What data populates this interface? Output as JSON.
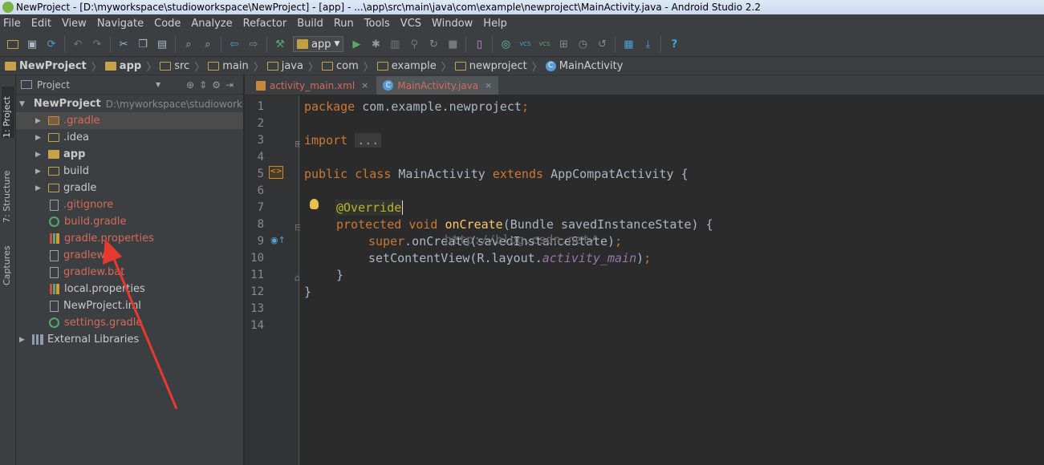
{
  "window": {
    "title": "NewProject - [D:\\myworkspace\\studioworkspace\\NewProject] - [app] - ...\\app\\src\\main\\java\\com\\example\\newproject\\MainActivity.java - Android Studio 2.2"
  },
  "menu": [
    "File",
    "Edit",
    "View",
    "Navigate",
    "Code",
    "Analyze",
    "Refactor",
    "Build",
    "Run",
    "Tools",
    "VCS",
    "Window",
    "Help"
  ],
  "toolbar": {
    "run_config": "app",
    "vcs1": "VCS",
    "vcs2": "VCS",
    "help": "?"
  },
  "breadcrumb": [
    "NewProject",
    "app",
    "src",
    "main",
    "java",
    "com",
    "example",
    "newproject",
    "MainActivity"
  ],
  "side_tabs": {
    "project": "1: Project",
    "structure": "7: Structure",
    "captures": "Captures"
  },
  "project_panel": {
    "header": "Project",
    "root": {
      "name": "NewProject",
      "path": "D:\\myworkspace\\studioworkspace\\NewProject"
    },
    "items": [
      {
        "name": ".gradle"
      },
      {
        "name": ".idea"
      },
      {
        "name": "app"
      },
      {
        "name": "build"
      },
      {
        "name": "gradle"
      },
      {
        "name": ".gitignore"
      },
      {
        "name": "build.gradle"
      },
      {
        "name": "gradle.properties"
      },
      {
        "name": "gradlew"
      },
      {
        "name": "gradlew.bat"
      },
      {
        "name": "local.properties"
      },
      {
        "name": "NewProject.iml"
      },
      {
        "name": "settings.gradle"
      },
      {
        "name": "External Libraries"
      }
    ]
  },
  "tabs": [
    {
      "label": "activity_main.xml"
    },
    {
      "label": "MainActivity.java"
    }
  ],
  "editor": {
    "line_numbers": [
      "1",
      "2",
      "3",
      "4",
      "5",
      "6",
      "7",
      "8",
      "9",
      "10",
      "11",
      "12",
      "13",
      "14"
    ],
    "l1_kw": "package",
    "l1_rest": " com.example.newproject",
    "semi": ";",
    "l3_kw": "import",
    "l3_fold": "...",
    "l6_kw1": "public",
    "l6_kw2": "class",
    "l6_name": "MainActivity",
    "l6_kw3": "extends",
    "l6_rest": "AppCompatActivity {",
    "l8_ann": "@Override",
    "l9_kw1": "protected",
    "l9_kw2": "void",
    "l9_fn": "onCreate",
    "l9_rest": "(Bundle savedInstanceState) {",
    "l10_kw": "super",
    "l10_rest": ".onCreate(savedInstanceState)",
    "l11_a": "setContentView(R.layout.",
    "l11_it": "activity_main",
    "l11_b": ")",
    "l12": "}",
    "l13": "}",
    "watermark": "http://blog.csdn.net/"
  }
}
